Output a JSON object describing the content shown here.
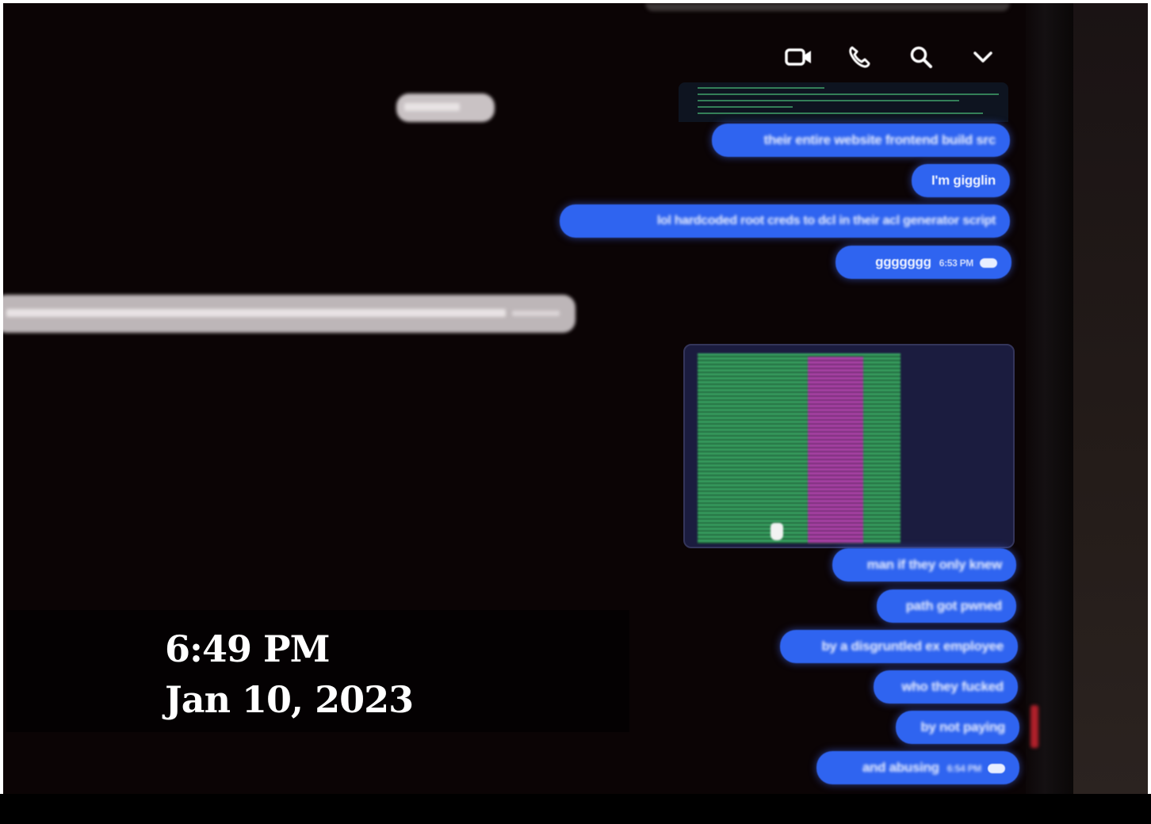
{
  "header": {
    "icons": [
      "video-camera-icon",
      "phone-icon",
      "search-icon",
      "chevron-down-icon"
    ]
  },
  "conversation": {
    "outgoing_top": [
      {
        "text": "their entire website frontend build src"
      },
      {
        "text": "I'm gigglin"
      },
      {
        "text": "lol hardcoded root creds to dcl in their acl generator script"
      },
      {
        "text": "ggggggg",
        "time": "6:53 PM"
      }
    ],
    "outgoing_bottom": [
      {
        "text": "man if they only knew"
      },
      {
        "text": "path got pwned"
      },
      {
        "text": "by a disgruntled ex employee"
      },
      {
        "text": "who they fucked"
      },
      {
        "text": "by not paying"
      },
      {
        "text": "and abusing",
        "time": "6:54 PM"
      }
    ]
  },
  "overlay": {
    "time": "6:49 PM",
    "date": "Jan 10, 2023"
  },
  "colors": {
    "bubble": "#2f64f0",
    "background": "#0b0405"
  }
}
